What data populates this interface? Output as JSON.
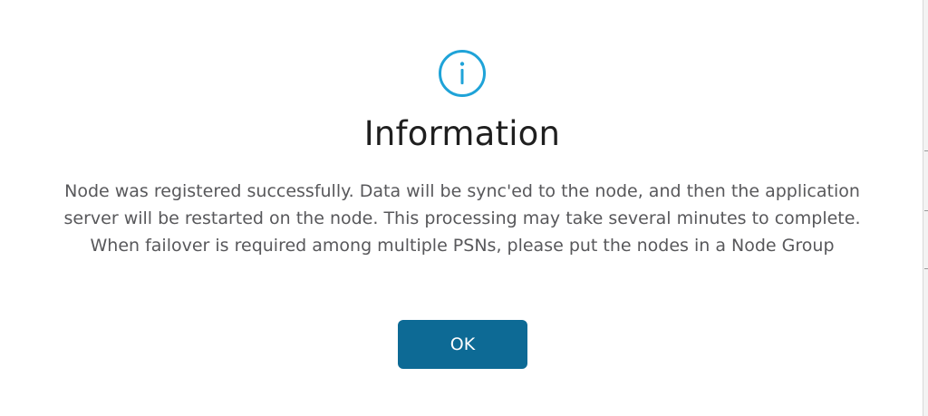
{
  "dialog": {
    "icon": "info-circle-icon",
    "title": "Information",
    "message": "Node was registered successfully. Data will be sync'ed to the node, and then the application server will be restarted on the node. This processing may take several minutes to complete. When failover is required among multiple PSNs, please put the nodes in a Node Group",
    "ok_label": "OK"
  },
  "colors": {
    "icon_accent": "#1fa3d8",
    "button_bg": "#0d6a95",
    "title_text": "#1f1f1f",
    "body_text": "#58585b"
  }
}
